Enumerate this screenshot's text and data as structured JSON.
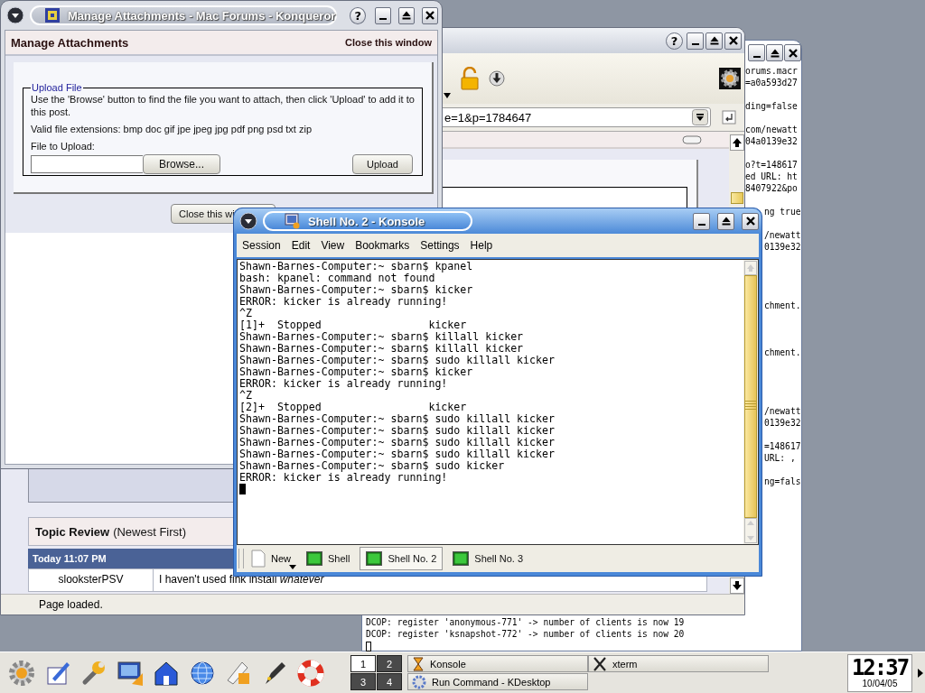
{
  "xterm_window": {
    "right_fragments": [
      "orums.macr",
      "=a0a593d27",
      "ding=false",
      "com/newatt",
      "04a0139e32",
      "o?t=148617",
      "ed URL: ht",
      "8407922&po",
      "ng true",
      "/newatt",
      "0139e32",
      "chment.",
      "chment.",
      "/newatt",
      "0139e32",
      "=148617",
      "URL: ,",
      "ng=fals"
    ],
    "bottom_lines": [
      "DCOP: register 'anonymous-771' -> number of clients is now 19",
      "DCOP: register 'ksnapshot-772' -> number of clients is now 20"
    ]
  },
  "konqueror_window": {
    "help_button": "?",
    "url": "e=1&p=1784647",
    "topic_review": {
      "title": "Topic Review",
      "note": "(Newest First)"
    },
    "post_date": "Today 11:07 PM",
    "post": {
      "author": "slooksterPSV",
      "text": "I haven't used fink install *whatever*"
    },
    "status": "Page loaded."
  },
  "attachments_window": {
    "title": "Manage Attachments - Mac Forums - Konqueror",
    "help_button": "?",
    "header": "Manage Attachments",
    "close_link": "Close this window",
    "legend": "Upload File",
    "instructions": "Use the 'Browse' button to find the file you want to attach, then click 'Upload' to add it to this post.",
    "extensions": "Valid file extensions: bmp doc gif jpe jpeg jpg pdf png psd txt zip",
    "file_label": "File to Upload:",
    "browse_button": "Browse...",
    "upload_button": "Upload",
    "close_button": "Close this wi"
  },
  "konsole_window": {
    "title": "Shell No. 2 - Konsole",
    "menu": [
      "Session",
      "Edit",
      "View",
      "Bookmarks",
      "Settings",
      "Help"
    ],
    "lines": [
      "Shawn-Barnes-Computer:~ sbarn$ kpanel",
      "bash: kpanel: command not found",
      "Shawn-Barnes-Computer:~ sbarn$ kicker",
      "ERROR: kicker is already running!",
      "^Z",
      "[1]+  Stopped                 kicker",
      "Shawn-Barnes-Computer:~ sbarn$ killall kicker",
      "Shawn-Barnes-Computer:~ sbarn$ killall kicker",
      "Shawn-Barnes-Computer:~ sbarn$ sudo killall kicker",
      "Shawn-Barnes-Computer:~ sbarn$ kicker",
      "ERROR: kicker is already running!",
      "^Z",
      "[2]+  Stopped                 kicker",
      "Shawn-Barnes-Computer:~ sbarn$ sudo killall kicker",
      "Shawn-Barnes-Computer:~ sbarn$ sudo killall kicker",
      "Shawn-Barnes-Computer:~ sbarn$ sudo killall kicker",
      "Shawn-Barnes-Computer:~ sbarn$ sudo killall kicker",
      "Shawn-Barnes-Computer:~ sbarn$ sudo kicker",
      "ERROR: kicker is already running!"
    ],
    "new_button": "New",
    "tabs": [
      {
        "label": "Shell",
        "selected": false
      },
      {
        "label": "Shell No. 2",
        "selected": true
      },
      {
        "label": "Shell No. 3",
        "selected": false
      }
    ]
  },
  "taskbar": {
    "pager": [
      {
        "label": "1",
        "selected": true
      },
      {
        "label": "2",
        "selected": false
      },
      {
        "label": "3",
        "selected": false
      },
      {
        "label": "4",
        "selected": false
      }
    ],
    "tasks": [
      {
        "label": "Konsole",
        "kind": "konsole"
      },
      {
        "label": "xterm",
        "kind": "xterm"
      },
      {
        "label": "Run Command - KDesktop",
        "kind": "run"
      }
    ],
    "clock": "12:37",
    "date": "10/04/05"
  }
}
